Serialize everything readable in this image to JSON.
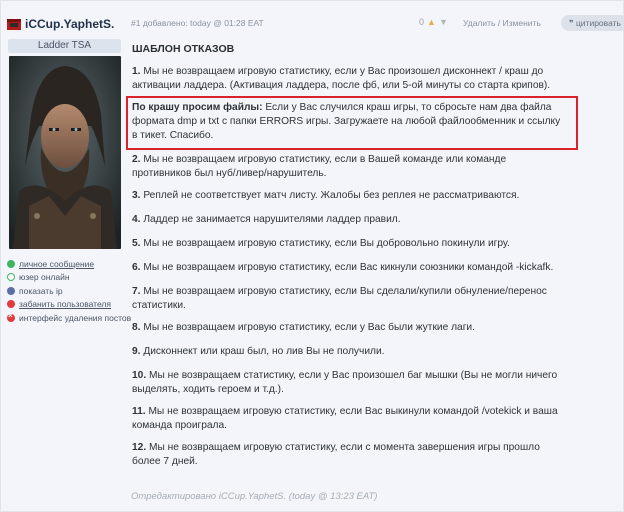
{
  "user": {
    "name": "iCCup.YaphetS.",
    "rank": "Ladder TSA",
    "links": [
      {
        "label": "личное сообщение",
        "icon": "message-icon",
        "underline": true
      },
      {
        "label": "юзер онлайн",
        "icon": "online-icon",
        "underline": false
      },
      {
        "label": "показать ip",
        "icon": "ip-icon",
        "underline": false
      },
      {
        "label": "забанить пользователя",
        "icon": "ban-icon",
        "underline": true
      },
      {
        "label": "интерфейс удаления постов",
        "icon": "delete-icon",
        "underline": false
      }
    ]
  },
  "post": {
    "meta": "#1 добавлено: today @ 01:28 EAT",
    "votes": "0",
    "actions": "Удалить / Изменить",
    "quote_label": "цитировать",
    "title": "ШАБЛОН ОТКАЗОВ",
    "rules": [
      {
        "num": "1.",
        "text": " Мы не возвращаем игровую статистику, если у Вас произошел дисконнект / краш до активации ладдера. (Активация ладдера, после фб, или 5-ой минуты со старта крипов)."
      },
      {
        "num": "По крашу просим файлы:",
        "text": " Если у Вас случился краш игры, то сбросьте нам два файла формата dmp и txt с папки ERRORS игры. Загружаете на любой файлообменник и ссылку в тикет. Спасибо."
      },
      {
        "num": "2.",
        "text": " Мы не возвращаем игровую статистику, если в Вашей команде или команде противников был нуб/ливер/нарушитель."
      },
      {
        "num": "3.",
        "text": " Реплей не соответствует матч листу. Жалобы без реплея не рассматриваются."
      },
      {
        "num": "4.",
        "text": " Ладдер не занимается нарушителями ладдер правил."
      },
      {
        "num": "5.",
        "text": " Мы не возвращаем игровую статистику, если Вы добровольно покинули игру."
      },
      {
        "num": "6.",
        "text": " Мы не возвращаем игровую статистику, если Вас кикнули союзники командой -kickafk."
      },
      {
        "num": "7.",
        "text": " Мы не возвращаем игровую статистику, если Вы сделали/купили обнуление/перенос статистики."
      },
      {
        "num": "8.",
        "text": " Мы не возвращаем игровую статистику, если у Вас были жуткие лаги."
      },
      {
        "num": "9.",
        "text": " Дисконнект или краш был, но лив Вы не получили."
      },
      {
        "num": "10.",
        "text": " Мы не возвращаем статистику, если у Вас произошел баг мышки (Вы не могли ничего выделять, ходить героем и т.д.)."
      },
      {
        "num": "11.",
        "text": " Мы не возвращаем игровую статистику, если Вас выкинули командой /votekick и ваша команда проиграла."
      },
      {
        "num": "12.",
        "text": " Мы не возвращаем игровую статистику, если с момента завершения игры прошло более 7 дней."
      }
    ],
    "edited": "Отредактировано iCCup.YaphetS. (today @ 13:23 EAT)"
  },
  "colors": {
    "highlight": "#d9222a",
    "accent_green": "#3fb562",
    "accent_red": "#e23b3b"
  }
}
